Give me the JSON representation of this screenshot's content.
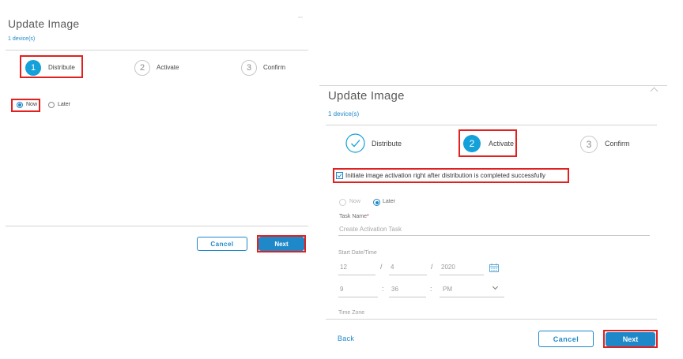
{
  "left_panel": {
    "title": "Update Image",
    "subtitle": "1 device(s)",
    "close_glyph": "ˇˇ",
    "steps": [
      {
        "number": "1",
        "label": "Distribute",
        "state": "active"
      },
      {
        "number": "2",
        "label": "Activate",
        "state": "idle"
      },
      {
        "number": "3",
        "label": "Confirm",
        "state": "idle"
      }
    ],
    "schedule": {
      "options": [
        {
          "label": "Now",
          "selected": true
        },
        {
          "label": "Later",
          "selected": false
        }
      ]
    },
    "footer": {
      "cancel_label": "Cancel",
      "next_label": "Next"
    }
  },
  "right_panel": {
    "title": "Update Image",
    "subtitle": "1 device(s)",
    "steps": [
      {
        "number": "1",
        "label": "Distribute",
        "state": "completed"
      },
      {
        "number": "2",
        "label": "Activate",
        "state": "active"
      },
      {
        "number": "3",
        "label": "Confirm",
        "state": "idle"
      }
    ],
    "activation_checkbox": {
      "label": "Initiate image activation right after distribution is completed successfully",
      "checked": true
    },
    "schedule": {
      "options": [
        {
          "label": "Now",
          "selected": false,
          "disabled": true
        },
        {
          "label": "Later",
          "selected": true,
          "disabled": false
        }
      ]
    },
    "task_name": {
      "label": "Task Name",
      "required_mark": "*",
      "placeholder": "Create Activation Task"
    },
    "start_datetime": {
      "label": "Start Date/Time",
      "month": "12",
      "day": "4",
      "year": "2020",
      "date_separator": "/",
      "hour": "9",
      "minute": "36",
      "time_separator": ":",
      "ampm": "PM"
    },
    "time_zone": {
      "label": "Time Zone"
    },
    "footer": {
      "back_label": "Back",
      "cancel_label": "Cancel",
      "next_label": "Next"
    }
  },
  "colors": {
    "accent": "#1e88c9",
    "step_active": "#14a0d8",
    "highlight_box": "#e0211f",
    "required": "#e0211f"
  },
  "icons": {
    "completed_step": "check-circle-icon",
    "calendar": "calendar-icon",
    "dropdown": "chevron-down-icon"
  }
}
